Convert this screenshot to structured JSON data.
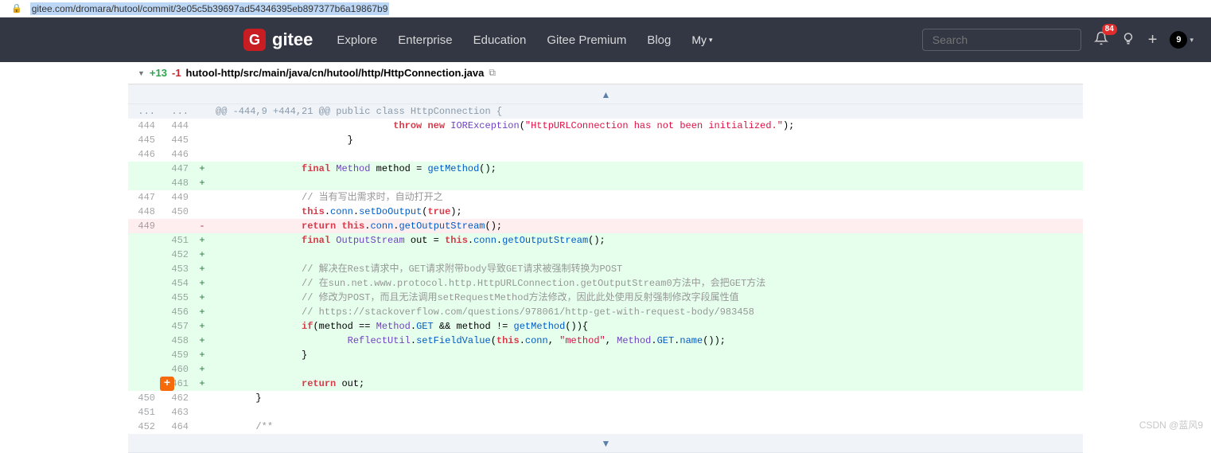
{
  "url": "gitee.com/dromara/hutool/commit/3e05c5b39697ad54346395eb897377b6a19867b9",
  "logo": "gitee",
  "nav": {
    "explore": "Explore",
    "enterprise": "Enterprise",
    "education": "Education",
    "premium": "Gitee Premium",
    "blog": "Blog",
    "my": "My"
  },
  "search_placeholder": "Search",
  "badge_count": "84",
  "avatar_text": "9",
  "file": {
    "additions": "+13",
    "deletions": "-1",
    "path": "hutool-http/src/main/java/cn/hutool/http/HttpConnection.java"
  },
  "hunk_header": "@@ -444,9 +444,21 @@ public class HttpConnection {",
  "lines": [
    {
      "old": "444",
      "new": "444",
      "type": "ctx",
      "html": "                               <span class='k'>throw</span> <span class='k'>new</span> <span class='t'>IORException</span>(<span class='s'>\"HttpURLConnection has not been initialized.\"</span>);"
    },
    {
      "old": "445",
      "new": "445",
      "type": "ctx",
      "html": "                       }"
    },
    {
      "old": "446",
      "new": "446",
      "type": "ctx",
      "html": ""
    },
    {
      "old": "",
      "new": "447",
      "type": "add",
      "html": "               <span class='k'>final</span> <span class='t'>Method</span> method = <span class='m'>getMethod</span>();"
    },
    {
      "old": "",
      "new": "448",
      "type": "add",
      "html": ""
    },
    {
      "old": "447",
      "new": "449",
      "type": "ctx",
      "html": "               <span class='c'>// 当有写出需求时，自动打开之</span>"
    },
    {
      "old": "448",
      "new": "450",
      "type": "ctx",
      "html": "               <span class='k'>this</span>.<span class='n'>conn</span>.<span class='m'>setDoOutput</span>(<span class='k'>true</span>);"
    },
    {
      "old": "449",
      "new": "",
      "type": "del",
      "html": "               <span class='k'>return</span> <span class='k'>this</span>.<span class='n'>conn</span>.<span class='m'>getOutputStream</span>();"
    },
    {
      "old": "",
      "new": "451",
      "type": "add",
      "html": "               <span class='k'>final</span> <span class='t'>OutputStream</span> out = <span class='k'>this</span>.<span class='n'>conn</span>.<span class='m'>getOutputStream</span>();"
    },
    {
      "old": "",
      "new": "452",
      "type": "add",
      "html": ""
    },
    {
      "old": "",
      "new": "453",
      "type": "add",
      "html": "               <span class='c'>// 解决在Rest请求中，GET请求附带body导致GET请求被强制转换为POST</span>"
    },
    {
      "old": "",
      "new": "454",
      "type": "add",
      "html": "               <span class='c'>// 在sun.net.www.protocol.http.HttpURLConnection.getOutputStream0方法中，会把GET方法</span>"
    },
    {
      "old": "",
      "new": "455",
      "type": "add",
      "html": "               <span class='c'>// 修改为POST，而且无法调用setRequestMethod方法修改，因此此处使用反射强制修改字段属性值</span>"
    },
    {
      "old": "",
      "new": "456",
      "type": "add",
      "html": "               <span class='c'>// https://stackoverflow.com/questions/978061/http-get-with-request-body/983458</span>"
    },
    {
      "old": "",
      "new": "457",
      "type": "add",
      "html": "               <span class='k'>if</span>(method == <span class='t'>Method</span>.<span class='n'>GET</span> &amp;&amp; method != <span class='m'>getMethod</span>()){"
    },
    {
      "old": "",
      "new": "458",
      "type": "add",
      "html": "                       <span class='t'>ReflectUtil</span>.<span class='m'>setFieldValue</span>(<span class='k'>this</span>.<span class='n'>conn</span>, <span class='s'>\"method\"</span>, <span class='t'>Method</span>.<span class='n'>GET</span>.<span class='m'>name</span>());"
    },
    {
      "old": "",
      "new": "459",
      "type": "add",
      "html": "               }"
    },
    {
      "old": "",
      "new": "460",
      "type": "add",
      "html": ""
    },
    {
      "old": "",
      "new": "461",
      "type": "add",
      "html": "               <span class='k'>return</span> out;",
      "btn": true
    },
    {
      "old": "450",
      "new": "462",
      "type": "ctx",
      "html": "       }"
    },
    {
      "old": "451",
      "new": "463",
      "type": "ctx",
      "html": ""
    },
    {
      "old": "452",
      "new": "464",
      "type": "ctx",
      "html": "       <span class='c'>/**</span>"
    }
  ],
  "watermark": "CSDN @蓝风9"
}
